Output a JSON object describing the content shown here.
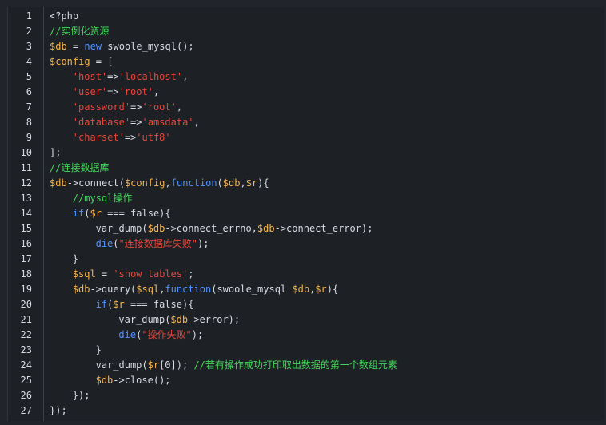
{
  "colors": {
    "background": "#1d2126",
    "plain": "#d7dae0",
    "variable": "#f6b44b",
    "keyword": "#4f93ff",
    "string": "#e8463a",
    "comment": "#43d65a",
    "gutter_border": "#3b4048"
  },
  "lines": [
    {
      "n": "1",
      "indent": 0,
      "tokens": [
        [
          "plain",
          "<?php"
        ]
      ]
    },
    {
      "n": "2",
      "indent": 0,
      "tokens": [
        [
          "comment",
          "//实例化资源"
        ]
      ]
    },
    {
      "n": "3",
      "indent": 0,
      "tokens": [
        [
          "var",
          "$db"
        ],
        [
          "plain",
          " = "
        ],
        [
          "keyword",
          "new"
        ],
        [
          "plain",
          " swoole_mysql();"
        ]
      ]
    },
    {
      "n": "4",
      "indent": 0,
      "tokens": [
        [
          "var",
          "$config"
        ],
        [
          "plain",
          " = ["
        ]
      ]
    },
    {
      "n": "5",
      "indent": 1,
      "tokens": [
        [
          "string",
          "'host'"
        ],
        [
          "plain",
          "=>"
        ],
        [
          "string",
          "'localhost'"
        ],
        [
          "plain",
          ","
        ]
      ]
    },
    {
      "n": "6",
      "indent": 1,
      "tokens": [
        [
          "string",
          "'user'"
        ],
        [
          "plain",
          "=>"
        ],
        [
          "string",
          "'root'"
        ],
        [
          "plain",
          ","
        ]
      ]
    },
    {
      "n": "7",
      "indent": 1,
      "tokens": [
        [
          "string",
          "'password'"
        ],
        [
          "plain",
          "=>"
        ],
        [
          "string",
          "'root'"
        ],
        [
          "plain",
          ","
        ]
      ]
    },
    {
      "n": "8",
      "indent": 1,
      "tokens": [
        [
          "string",
          "'database'"
        ],
        [
          "plain",
          "=>"
        ],
        [
          "string",
          "'amsdata'"
        ],
        [
          "plain",
          ","
        ]
      ]
    },
    {
      "n": "9",
      "indent": 1,
      "tokens": [
        [
          "string",
          "'charset'"
        ],
        [
          "plain",
          "=>"
        ],
        [
          "string",
          "'utf8'"
        ]
      ]
    },
    {
      "n": "10",
      "indent": 0,
      "tokens": [
        [
          "plain",
          "];"
        ]
      ]
    },
    {
      "n": "11",
      "indent": 0,
      "tokens": [
        [
          "comment",
          "//连接数据库"
        ]
      ]
    },
    {
      "n": "12",
      "indent": 0,
      "tokens": [
        [
          "var",
          "$db"
        ],
        [
          "plain",
          "->connect("
        ],
        [
          "var",
          "$config"
        ],
        [
          "plain",
          ","
        ],
        [
          "keyword",
          "function"
        ],
        [
          "plain",
          "("
        ],
        [
          "var",
          "$db"
        ],
        [
          "plain",
          ","
        ],
        [
          "var",
          "$r"
        ],
        [
          "plain",
          "){"
        ]
      ]
    },
    {
      "n": "13",
      "indent": 1,
      "tokens": [
        [
          "comment",
          "//mysql操作"
        ]
      ]
    },
    {
      "n": "14",
      "indent": 1,
      "tokens": [
        [
          "keyword",
          "if"
        ],
        [
          "plain",
          "("
        ],
        [
          "var",
          "$r"
        ],
        [
          "plain",
          " === false){"
        ]
      ]
    },
    {
      "n": "15",
      "indent": 2,
      "tokens": [
        [
          "plain",
          "var_dump("
        ],
        [
          "var",
          "$db"
        ],
        [
          "plain",
          "->connect_errno,"
        ],
        [
          "var",
          "$db"
        ],
        [
          "plain",
          "->connect_error);"
        ]
      ]
    },
    {
      "n": "16",
      "indent": 2,
      "tokens": [
        [
          "keyword",
          "die"
        ],
        [
          "plain",
          "("
        ],
        [
          "string",
          "\"连接数据库失败\""
        ],
        [
          "plain",
          ");"
        ]
      ]
    },
    {
      "n": "17",
      "indent": 1,
      "tokens": [
        [
          "plain",
          "}"
        ]
      ]
    },
    {
      "n": "18",
      "indent": 1,
      "tokens": [
        [
          "var",
          "$sql"
        ],
        [
          "plain",
          " = "
        ],
        [
          "string",
          "'show tables'"
        ],
        [
          "plain",
          ";"
        ]
      ]
    },
    {
      "n": "19",
      "indent": 1,
      "tokens": [
        [
          "var",
          "$db"
        ],
        [
          "plain",
          "->query("
        ],
        [
          "var",
          "$sql"
        ],
        [
          "plain",
          ","
        ],
        [
          "keyword",
          "function"
        ],
        [
          "plain",
          "(swoole_mysql "
        ],
        [
          "var",
          "$db"
        ],
        [
          "plain",
          ","
        ],
        [
          "var",
          "$r"
        ],
        [
          "plain",
          "){"
        ]
      ]
    },
    {
      "n": "20",
      "indent": 2,
      "tokens": [
        [
          "keyword",
          "if"
        ],
        [
          "plain",
          "("
        ],
        [
          "var",
          "$r"
        ],
        [
          "plain",
          " === false){"
        ]
      ]
    },
    {
      "n": "21",
      "indent": 3,
      "tokens": [
        [
          "plain",
          "var_dump("
        ],
        [
          "var",
          "$db"
        ],
        [
          "plain",
          "->error);"
        ]
      ]
    },
    {
      "n": "22",
      "indent": 3,
      "tokens": [
        [
          "keyword",
          "die"
        ],
        [
          "plain",
          "("
        ],
        [
          "string",
          "\"操作失败\""
        ],
        [
          "plain",
          ");"
        ]
      ]
    },
    {
      "n": "23",
      "indent": 2,
      "tokens": [
        [
          "plain",
          "}"
        ]
      ]
    },
    {
      "n": "24",
      "indent": 2,
      "tokens": [
        [
          "plain",
          "var_dump("
        ],
        [
          "var",
          "$r"
        ],
        [
          "plain",
          "[0]); "
        ],
        [
          "comment",
          "//若有操作成功打印取出数据的第一个数组元素"
        ]
      ]
    },
    {
      "n": "25",
      "indent": 2,
      "tokens": [
        [
          "var",
          "$db"
        ],
        [
          "plain",
          "->close();"
        ]
      ]
    },
    {
      "n": "26",
      "indent": 1,
      "tokens": [
        [
          "plain",
          "});"
        ]
      ]
    },
    {
      "n": "27",
      "indent": 0,
      "tokens": [
        [
          "plain",
          "});"
        ]
      ]
    }
  ]
}
